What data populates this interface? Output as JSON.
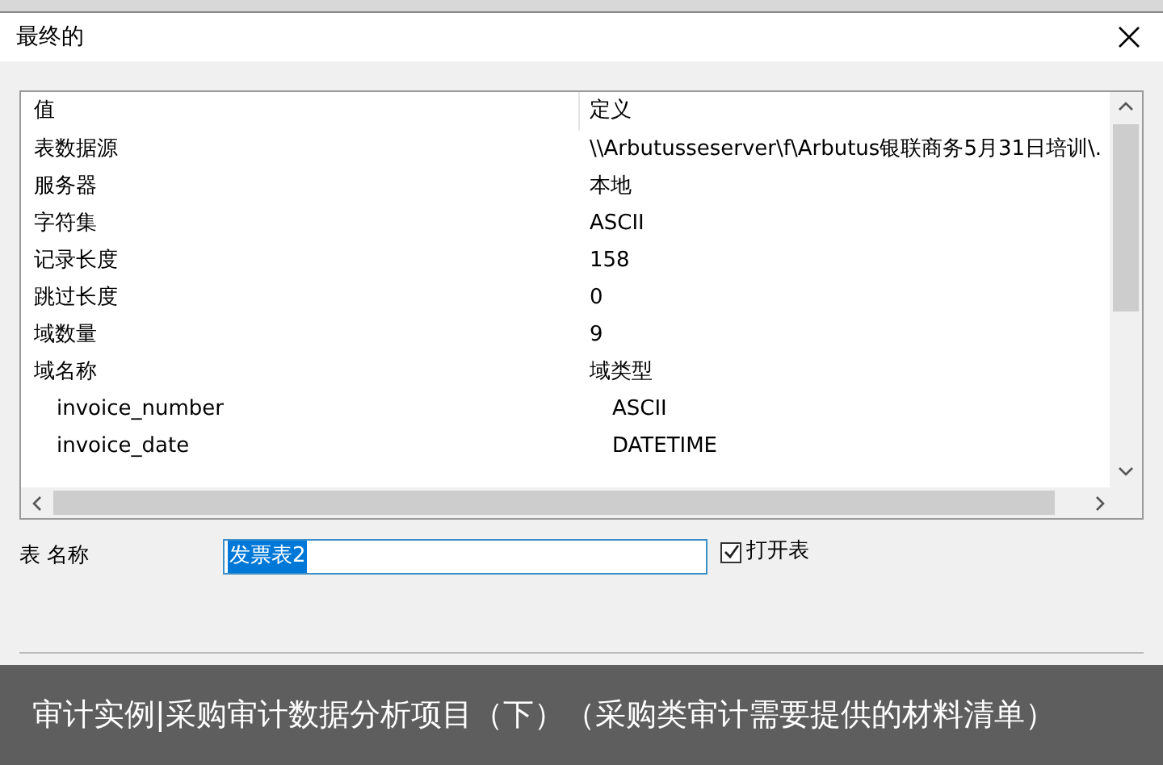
{
  "window": {
    "title": "最终的"
  },
  "table": {
    "columns": [
      "值",
      "定义"
    ],
    "rows": [
      {
        "name": "表数据源",
        "value": "\\\\Arbutusseserver\\f\\Arbutus银联商务5月31日培训\\.",
        "indent": false
      },
      {
        "name": "服务器",
        "value": "本地",
        "indent": false
      },
      {
        "name": "字符集",
        "value": "ASCII",
        "indent": false
      },
      {
        "name": "记录长度",
        "value": "158",
        "indent": false
      },
      {
        "name": "跳过长度",
        "value": "0",
        "indent": false
      },
      {
        "name": "域数量",
        "value": "9",
        "indent": false
      },
      {
        "name": "域名称",
        "value": "域类型",
        "indent": false
      },
      {
        "name": "invoice_number",
        "value": "ASCII",
        "indent": true
      },
      {
        "name": "invoice_date",
        "value": "DATETIME",
        "indent": true
      }
    ]
  },
  "table_name": {
    "label": "表 名称",
    "value": "发票表2",
    "selected": true
  },
  "open_table": {
    "label": "打开表",
    "checked": true
  },
  "caption": "审计实例|采购审计数据分析项目（下）（采购类审计需要提供的材料清单）"
}
